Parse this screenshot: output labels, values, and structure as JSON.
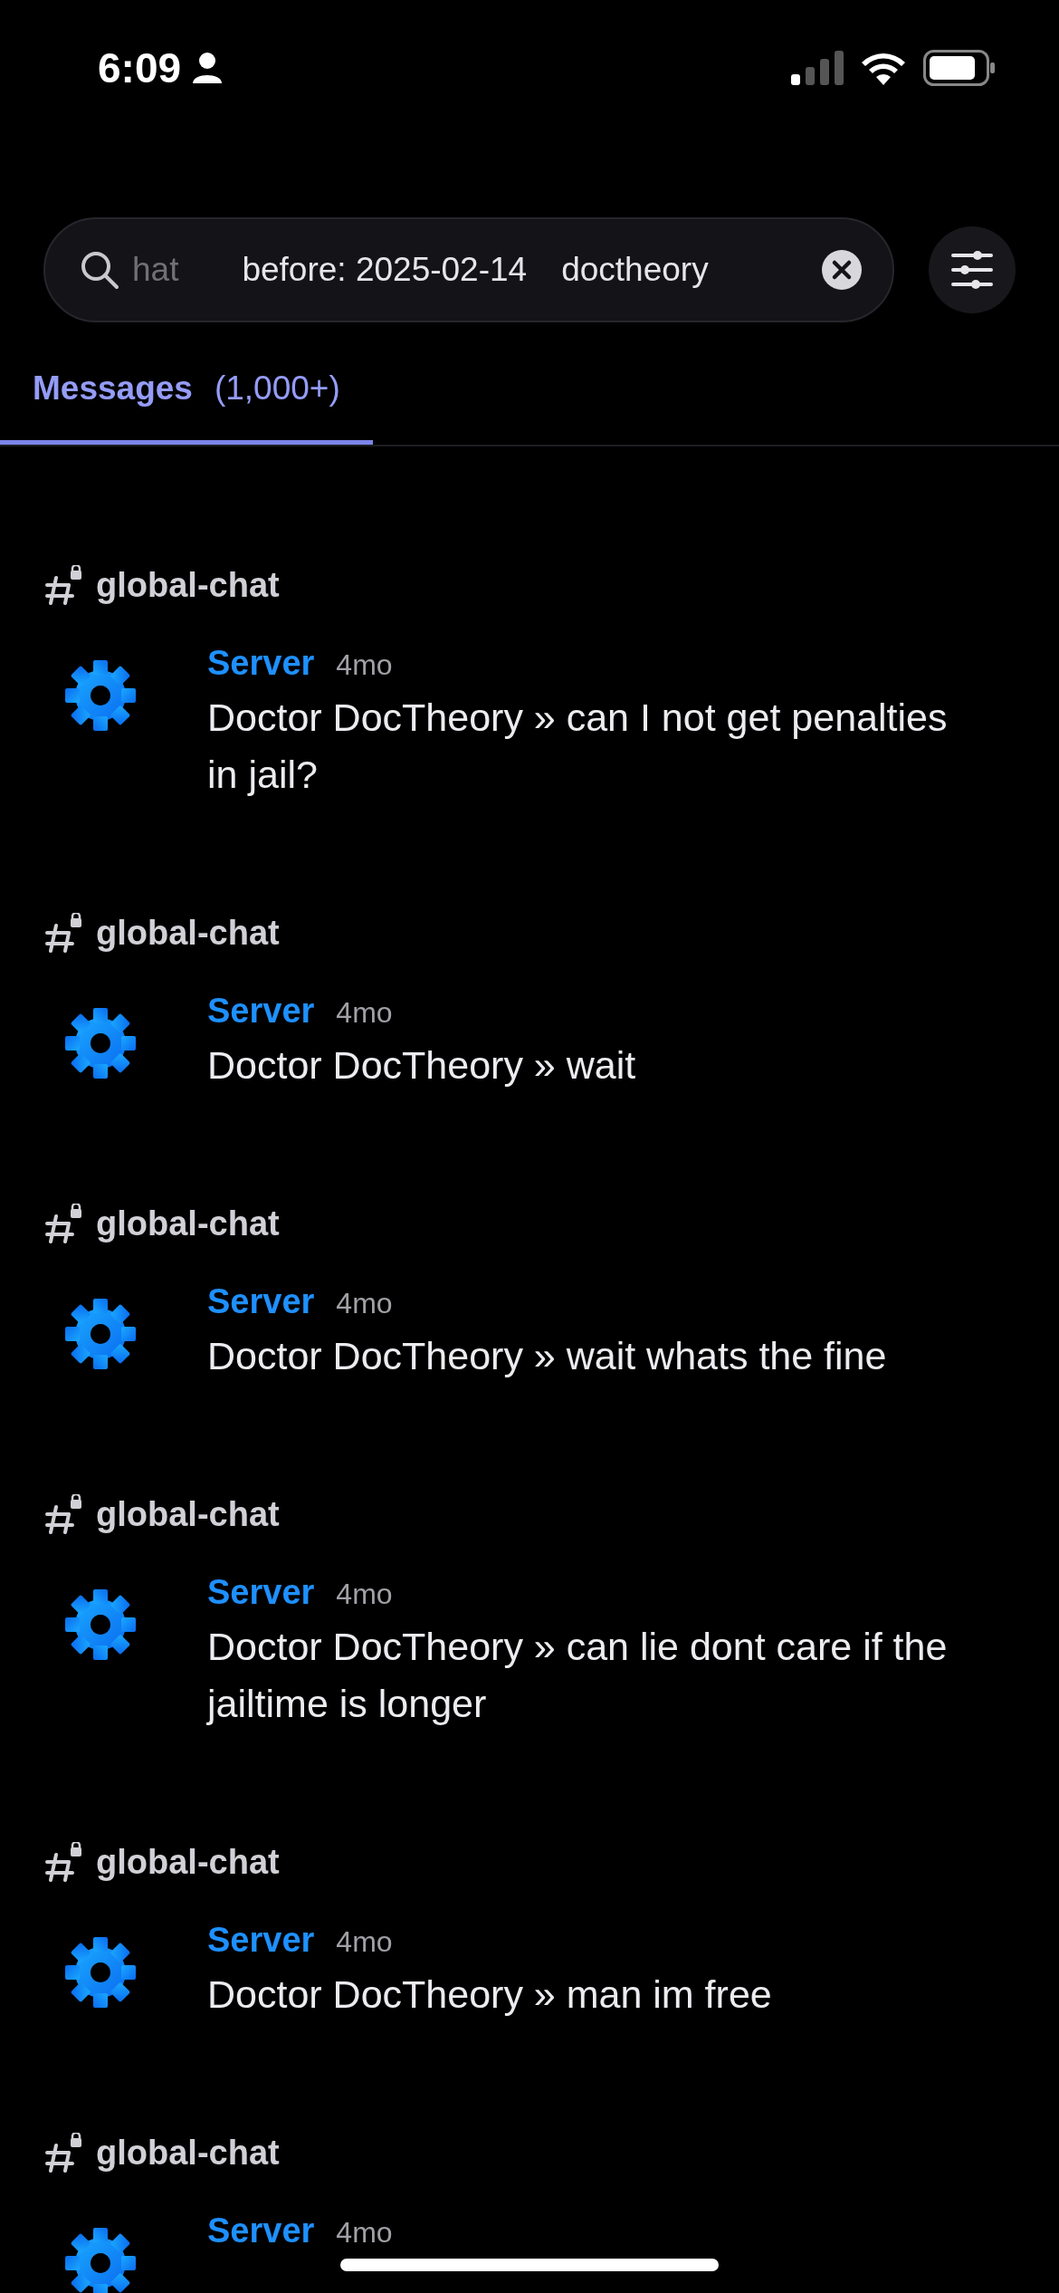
{
  "status_bar": {
    "time": "6:09"
  },
  "search": {
    "tokens": [
      {
        "text": "hat",
        "faded": true
      },
      {
        "text": "before: 2025-02-14",
        "faded": false
      },
      {
        "text": "doctheory",
        "faded": false
      }
    ]
  },
  "tabs": [
    {
      "label": "Messages",
      "count": "(1,000+)",
      "selected": true
    }
  ],
  "results": [
    {
      "channel": "global-chat",
      "author": "Server",
      "time": "4mo",
      "text": "Doctor DocTheory » can I not get penalties in jail?"
    },
    {
      "channel": "global-chat",
      "author": "Server",
      "time": "4mo",
      "text": "Doctor DocTheory » wait"
    },
    {
      "channel": "global-chat",
      "author": "Server",
      "time": "4mo",
      "text": "Doctor DocTheory » wait whats the fine"
    },
    {
      "channel": "global-chat",
      "author": "Server",
      "time": "4mo",
      "text": "Doctor DocTheory » can lie dont care if the jailtime is longer"
    },
    {
      "channel": "global-chat",
      "author": "Server",
      "time": "4mo",
      "text": "Doctor DocTheory » man im free"
    },
    {
      "channel": "global-chat",
      "author": "Server",
      "time": "4mo"
    }
  ]
}
